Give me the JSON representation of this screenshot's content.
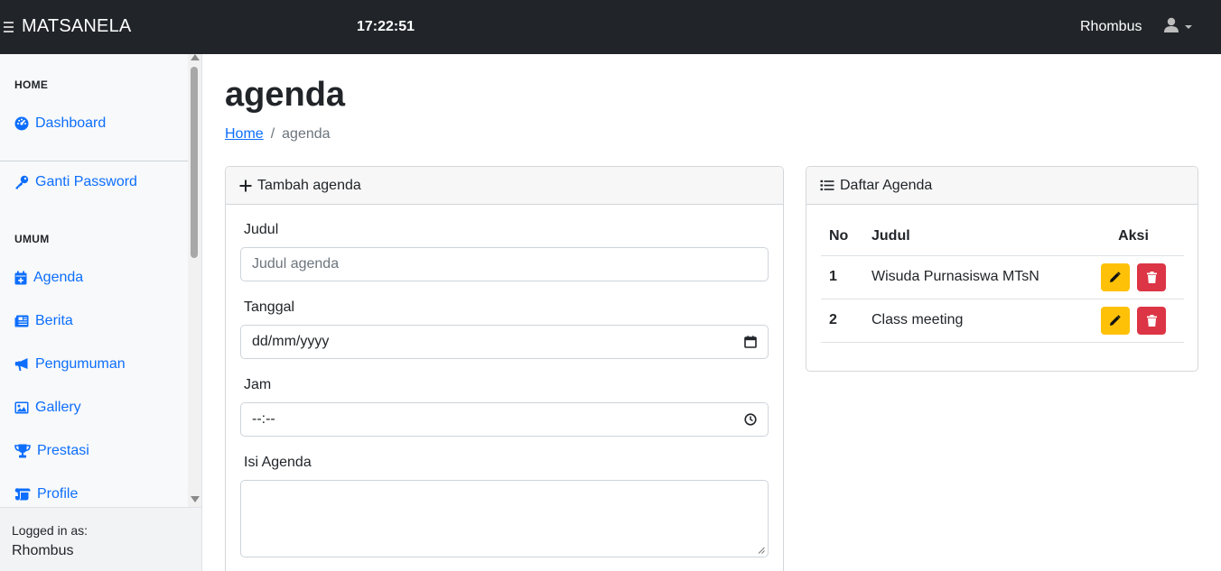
{
  "topbar": {
    "brand": "MATSANELA",
    "clock": "17:22:51",
    "username": "Rhombus"
  },
  "sidebar": {
    "sections": [
      {
        "heading": "HOME"
      },
      {
        "heading": "UMUM"
      }
    ],
    "items": [
      {
        "label": "Dashboard",
        "icon": "dashboard-icon"
      },
      {
        "label": "Ganti Password",
        "icon": "key-icon"
      },
      {
        "label": "Agenda",
        "icon": "calendar-icon"
      },
      {
        "label": "Berita",
        "icon": "newspaper-icon"
      },
      {
        "label": "Pengumuman",
        "icon": "megaphone-icon"
      },
      {
        "label": "Gallery",
        "icon": "image-icon"
      },
      {
        "label": "Prestasi",
        "icon": "trophy-icon"
      },
      {
        "label": "Profile",
        "icon": "scroll-icon"
      }
    ],
    "footer": {
      "label": "Logged in as:",
      "user": "Rhombus"
    }
  },
  "page": {
    "title": "agenda",
    "breadcrumb": {
      "home": "Home",
      "separator": "/",
      "current": "agenda"
    }
  },
  "form": {
    "header": "Tambah agenda",
    "fields": {
      "judul": {
        "label": "Judul",
        "placeholder": "Judul agenda"
      },
      "tanggal": {
        "label": "Tanggal",
        "value": "dd/mm/yyyy"
      },
      "jam": {
        "label": "Jam",
        "value": "--:--"
      },
      "isi": {
        "label": "Isi Agenda"
      }
    }
  },
  "list": {
    "header": "Daftar Agenda",
    "columns": {
      "no": "No",
      "judul": "Judul",
      "aksi": "Aksi"
    },
    "rows": [
      {
        "no": "1",
        "judul": "Wisuda Purnasiswa MTsN"
      },
      {
        "no": "2",
        "judul": "Class meeting"
      }
    ]
  },
  "colors": {
    "navbar": "#212529",
    "link": "#0d6efd",
    "edit": "#ffc107",
    "delete": "#dc3545"
  }
}
